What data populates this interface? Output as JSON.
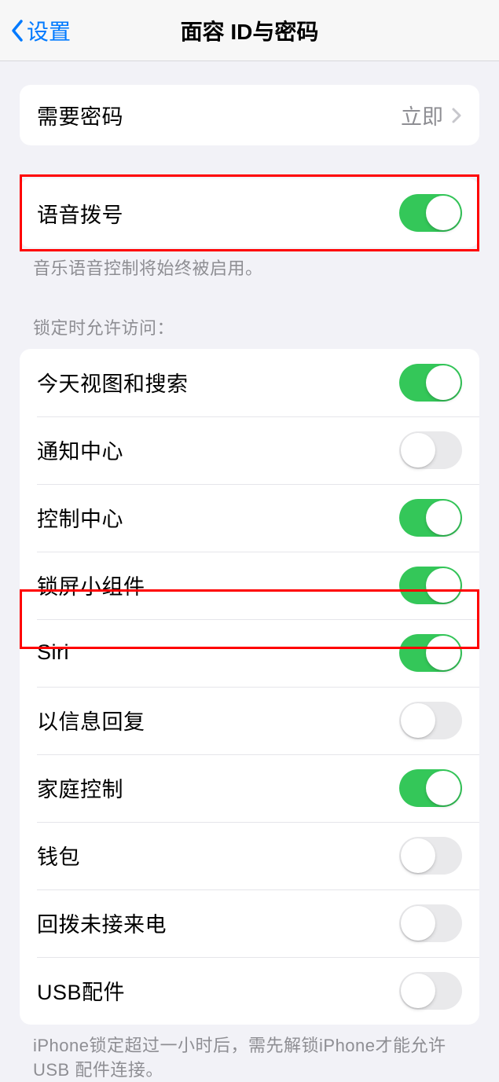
{
  "nav": {
    "back_label": "设置",
    "title": "面容 ID与密码"
  },
  "group1": {
    "require_passcode": {
      "label": "需要密码",
      "value": "立即"
    }
  },
  "group2": {
    "voice_dial": {
      "label": "语音拨号",
      "enabled": true
    },
    "footer": "音乐语音控制将始终被启用。"
  },
  "group3": {
    "header": "锁定时允许访问：",
    "items": [
      {
        "key": "today-view",
        "label": "今天视图和搜索",
        "enabled": true
      },
      {
        "key": "notification-center",
        "label": "通知中心",
        "enabled": false
      },
      {
        "key": "control-center",
        "label": "控制中心",
        "enabled": true
      },
      {
        "key": "lock-screen-widgets",
        "label": "锁屏小组件",
        "enabled": true
      },
      {
        "key": "siri",
        "label": "Siri",
        "enabled": true
      },
      {
        "key": "reply-with-message",
        "label": "以信息回复",
        "enabled": false
      },
      {
        "key": "home-control",
        "label": "家庭控制",
        "enabled": true
      },
      {
        "key": "wallet",
        "label": "钱包",
        "enabled": false
      },
      {
        "key": "return-missed-calls",
        "label": "回拨未接来电",
        "enabled": false
      },
      {
        "key": "usb-accessories",
        "label": "USB配件",
        "enabled": false
      }
    ],
    "footer": "iPhone锁定超过一小时后，需先解锁iPhone才能允许USB 配件连接。"
  }
}
